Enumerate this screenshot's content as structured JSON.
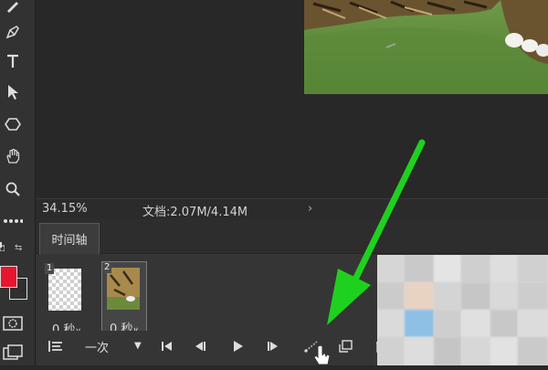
{
  "colors": {
    "foreground": "#e8152d",
    "background_swatch": "#2f2f2f",
    "accent_arrow": "#1fd11f"
  },
  "toolbar": {
    "tools": [
      "pen-icon",
      "pen-tool-icon",
      "text-icon",
      "path-select-icon",
      "shape-icon",
      "hand-icon",
      "zoom-icon",
      "more-icon"
    ]
  },
  "status": {
    "zoom": "34.15%",
    "doc": "文档:2.07M/4.14M",
    "arrow": "›"
  },
  "timeline": {
    "tab_label": "时间轴",
    "frames": [
      {
        "number": "1",
        "delay": "0 秒"
      },
      {
        "number": "2",
        "delay": "0 秒"
      }
    ],
    "loop_value": "一次"
  }
}
